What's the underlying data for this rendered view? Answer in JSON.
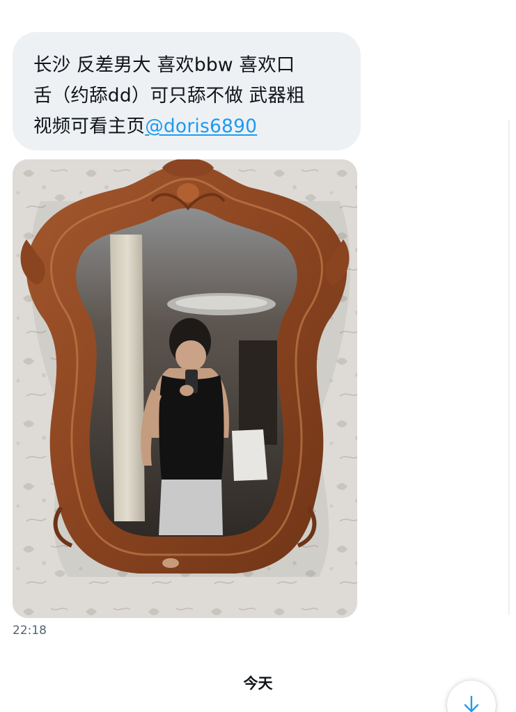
{
  "message": {
    "text_lines": [
      "长沙 反差男大 喜欢bbw 喜欢口",
      "舌（约舔dd）可只舔不做 武器粗",
      "视频可看主页"
    ],
    "mention": "@doris6890",
    "image": {
      "icon": "mirror-selfie-photo"
    },
    "timestamp": "22:18"
  },
  "day_divider": "今天",
  "scroll_button": {
    "icon": "arrow-down-icon"
  },
  "colors": {
    "bubble_bg": "#eef1f4",
    "text": "#0f1419",
    "link": "#1d9bf0",
    "muted": "#536471"
  }
}
